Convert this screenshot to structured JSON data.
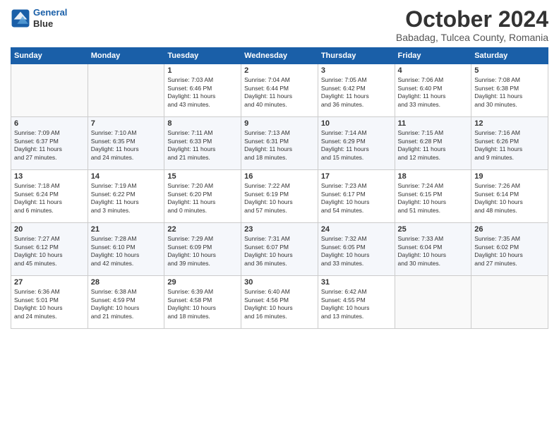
{
  "logo": {
    "line1": "General",
    "line2": "Blue"
  },
  "title": "October 2024",
  "subtitle": "Babadag, Tulcea County, Romania",
  "header_days": [
    "Sunday",
    "Monday",
    "Tuesday",
    "Wednesday",
    "Thursday",
    "Friday",
    "Saturday"
  ],
  "weeks": [
    [
      {
        "day": "",
        "info": ""
      },
      {
        "day": "",
        "info": ""
      },
      {
        "day": "1",
        "info": "Sunrise: 7:03 AM\nSunset: 6:46 PM\nDaylight: 11 hours\nand 43 minutes."
      },
      {
        "day": "2",
        "info": "Sunrise: 7:04 AM\nSunset: 6:44 PM\nDaylight: 11 hours\nand 40 minutes."
      },
      {
        "day": "3",
        "info": "Sunrise: 7:05 AM\nSunset: 6:42 PM\nDaylight: 11 hours\nand 36 minutes."
      },
      {
        "day": "4",
        "info": "Sunrise: 7:06 AM\nSunset: 6:40 PM\nDaylight: 11 hours\nand 33 minutes."
      },
      {
        "day": "5",
        "info": "Sunrise: 7:08 AM\nSunset: 6:38 PM\nDaylight: 11 hours\nand 30 minutes."
      }
    ],
    [
      {
        "day": "6",
        "info": "Sunrise: 7:09 AM\nSunset: 6:37 PM\nDaylight: 11 hours\nand 27 minutes."
      },
      {
        "day": "7",
        "info": "Sunrise: 7:10 AM\nSunset: 6:35 PM\nDaylight: 11 hours\nand 24 minutes."
      },
      {
        "day": "8",
        "info": "Sunrise: 7:11 AM\nSunset: 6:33 PM\nDaylight: 11 hours\nand 21 minutes."
      },
      {
        "day": "9",
        "info": "Sunrise: 7:13 AM\nSunset: 6:31 PM\nDaylight: 11 hours\nand 18 minutes."
      },
      {
        "day": "10",
        "info": "Sunrise: 7:14 AM\nSunset: 6:29 PM\nDaylight: 11 hours\nand 15 minutes."
      },
      {
        "day": "11",
        "info": "Sunrise: 7:15 AM\nSunset: 6:28 PM\nDaylight: 11 hours\nand 12 minutes."
      },
      {
        "day": "12",
        "info": "Sunrise: 7:16 AM\nSunset: 6:26 PM\nDaylight: 11 hours\nand 9 minutes."
      }
    ],
    [
      {
        "day": "13",
        "info": "Sunrise: 7:18 AM\nSunset: 6:24 PM\nDaylight: 11 hours\nand 6 minutes."
      },
      {
        "day": "14",
        "info": "Sunrise: 7:19 AM\nSunset: 6:22 PM\nDaylight: 11 hours\nand 3 minutes."
      },
      {
        "day": "15",
        "info": "Sunrise: 7:20 AM\nSunset: 6:20 PM\nDaylight: 11 hours\nand 0 minutes."
      },
      {
        "day": "16",
        "info": "Sunrise: 7:22 AM\nSunset: 6:19 PM\nDaylight: 10 hours\nand 57 minutes."
      },
      {
        "day": "17",
        "info": "Sunrise: 7:23 AM\nSunset: 6:17 PM\nDaylight: 10 hours\nand 54 minutes."
      },
      {
        "day": "18",
        "info": "Sunrise: 7:24 AM\nSunset: 6:15 PM\nDaylight: 10 hours\nand 51 minutes."
      },
      {
        "day": "19",
        "info": "Sunrise: 7:26 AM\nSunset: 6:14 PM\nDaylight: 10 hours\nand 48 minutes."
      }
    ],
    [
      {
        "day": "20",
        "info": "Sunrise: 7:27 AM\nSunset: 6:12 PM\nDaylight: 10 hours\nand 45 minutes."
      },
      {
        "day": "21",
        "info": "Sunrise: 7:28 AM\nSunset: 6:10 PM\nDaylight: 10 hours\nand 42 minutes."
      },
      {
        "day": "22",
        "info": "Sunrise: 7:29 AM\nSunset: 6:09 PM\nDaylight: 10 hours\nand 39 minutes."
      },
      {
        "day": "23",
        "info": "Sunrise: 7:31 AM\nSunset: 6:07 PM\nDaylight: 10 hours\nand 36 minutes."
      },
      {
        "day": "24",
        "info": "Sunrise: 7:32 AM\nSunset: 6:05 PM\nDaylight: 10 hours\nand 33 minutes."
      },
      {
        "day": "25",
        "info": "Sunrise: 7:33 AM\nSunset: 6:04 PM\nDaylight: 10 hours\nand 30 minutes."
      },
      {
        "day": "26",
        "info": "Sunrise: 7:35 AM\nSunset: 6:02 PM\nDaylight: 10 hours\nand 27 minutes."
      }
    ],
    [
      {
        "day": "27",
        "info": "Sunrise: 6:36 AM\nSunset: 5:01 PM\nDaylight: 10 hours\nand 24 minutes."
      },
      {
        "day": "28",
        "info": "Sunrise: 6:38 AM\nSunset: 4:59 PM\nDaylight: 10 hours\nand 21 minutes."
      },
      {
        "day": "29",
        "info": "Sunrise: 6:39 AM\nSunset: 4:58 PM\nDaylight: 10 hours\nand 18 minutes."
      },
      {
        "day": "30",
        "info": "Sunrise: 6:40 AM\nSunset: 4:56 PM\nDaylight: 10 hours\nand 16 minutes."
      },
      {
        "day": "31",
        "info": "Sunrise: 6:42 AM\nSunset: 4:55 PM\nDaylight: 10 hours\nand 13 minutes."
      },
      {
        "day": "",
        "info": ""
      },
      {
        "day": "",
        "info": ""
      }
    ]
  ]
}
